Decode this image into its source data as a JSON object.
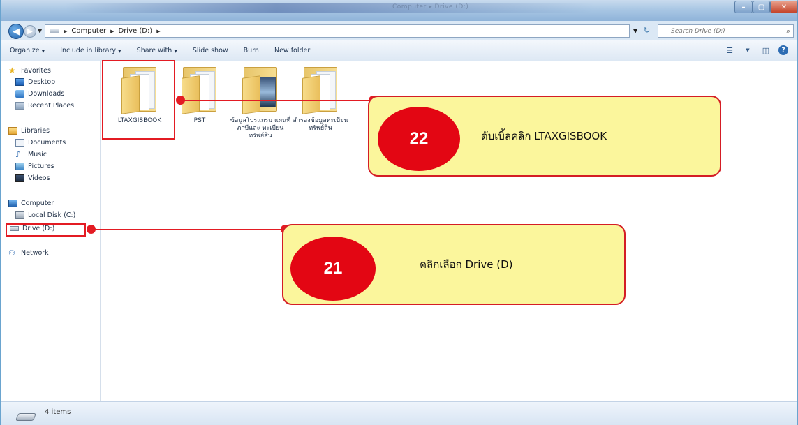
{
  "window": {
    "title": "Computer ▸ Drive (D:)"
  },
  "nav": {
    "back_glyph": "◀",
    "fwd_glyph": "▶"
  },
  "address": {
    "crumbs": [
      "Computer",
      "Drive (D:)"
    ],
    "search_placeholder": "Search Drive (D:)"
  },
  "toolbar": {
    "items": [
      "Organize",
      "Include in library",
      "Share with",
      "Slide show",
      "Burn",
      "New folder"
    ]
  },
  "sidebar": {
    "favorites": {
      "label": "Favorites",
      "items": [
        "Desktop",
        "Downloads",
        "Recent Places"
      ]
    },
    "libraries": {
      "label": "Libraries",
      "items": [
        "Documents",
        "Music",
        "Pictures",
        "Videos"
      ]
    },
    "computer": {
      "label": "Computer",
      "items": [
        "Local Disk (C:)",
        "Drive (D:)"
      ]
    },
    "network": {
      "label": "Network"
    }
  },
  "files": [
    {
      "name": "LTAXGISBOOK"
    },
    {
      "name": "PST"
    },
    {
      "name": "ข้อมูลโปรแกรม แผนที่ภาษีและ ทะเบียนทรัพย์สิน"
    },
    {
      "name": "สำรองข้อมูลทะเบียน ทรัพย์สิน"
    }
  ],
  "status": {
    "count": "4 items"
  },
  "annotations": {
    "step22": {
      "number": "22",
      "text": "ดับเบิ้ลคลิก  LTAXGISBOOK"
    },
    "step21": {
      "number": "21",
      "text": "คลิกเลือก    Drive (D)"
    }
  },
  "colors": {
    "accent_red": "#e31b23",
    "callout_fill": "#fbf69c"
  }
}
